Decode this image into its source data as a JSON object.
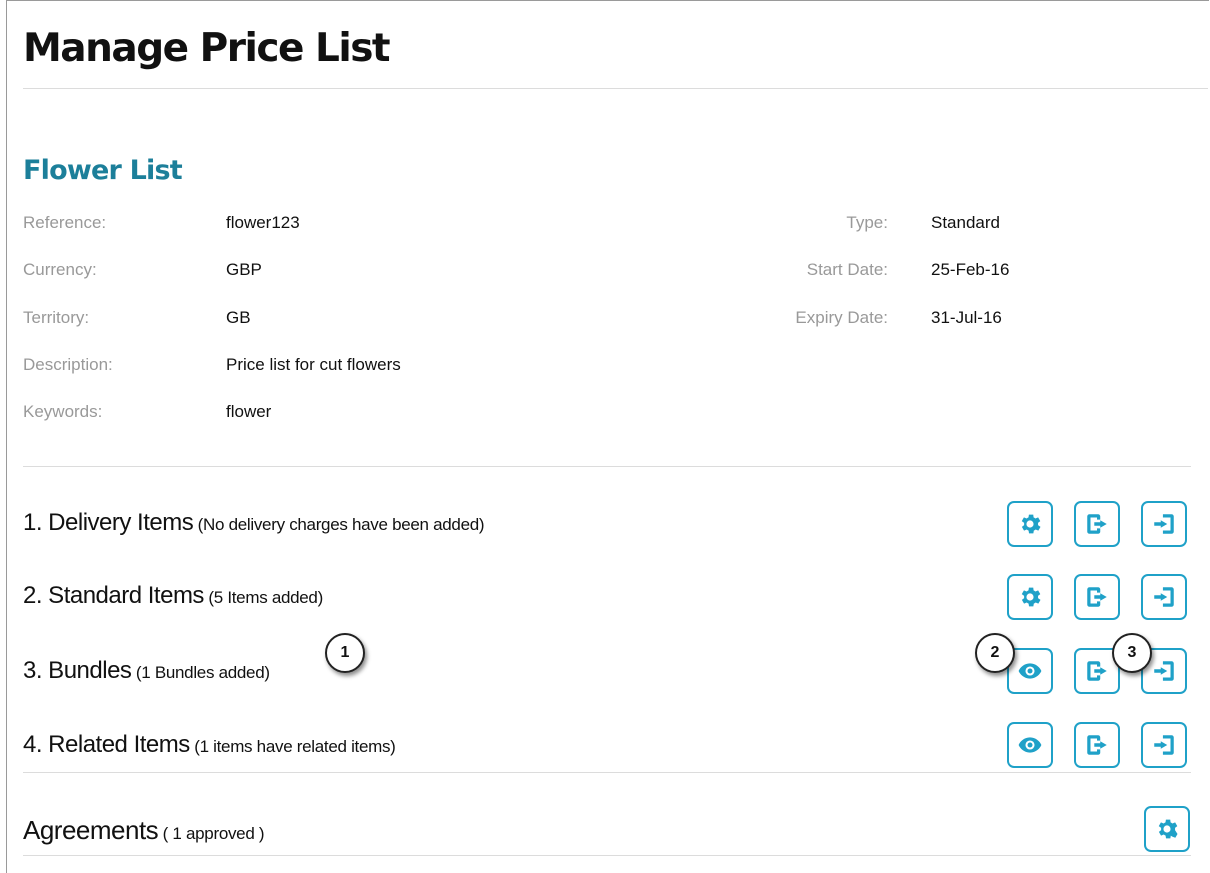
{
  "page": {
    "title": "Manage Price List"
  },
  "price_list": {
    "name": "Flower List",
    "fields_left": [
      {
        "label": "Reference:",
        "value": "flower123"
      },
      {
        "label": "Currency:",
        "value": "GBP"
      },
      {
        "label": "Territory:",
        "value": "GB"
      },
      {
        "label": "Description:",
        "value": "Price list for cut flowers"
      },
      {
        "label": "Keywords:",
        "value": "flower"
      }
    ],
    "fields_right": [
      {
        "label": "Type:",
        "value": "Standard"
      },
      {
        "label": "Start Date:",
        "value": "25-Feb-16"
      },
      {
        "label": "Expiry Date:",
        "value": "31-Jul-16"
      }
    ]
  },
  "sections": [
    {
      "title": "1. Delivery Items",
      "subtitle": "(No delivery charges have been added)",
      "actions": [
        "gear-icon",
        "export-icon",
        "import-icon"
      ]
    },
    {
      "title": "2. Standard Items",
      "subtitle": "(5 Items added)",
      "actions": [
        "gear-icon",
        "export-icon",
        "import-icon"
      ]
    },
    {
      "title": "3. Bundles",
      "subtitle": "(1 Bundles added)",
      "actions": [
        "eye-icon",
        "export-icon",
        "import-icon"
      ]
    },
    {
      "title": "4. Related Items",
      "subtitle": "(1 items have related items)",
      "actions": [
        "eye-icon",
        "export-icon",
        "import-icon"
      ]
    }
  ],
  "agreements": {
    "title": "Agreements",
    "subtitle": "( 1 approved )",
    "actions": [
      "gear-icon"
    ]
  },
  "callouts": [
    "1",
    "2",
    "3"
  ],
  "colors": {
    "accent": "#1fa1c8",
    "heading": "#1c7f9a",
    "label": "#999999"
  }
}
